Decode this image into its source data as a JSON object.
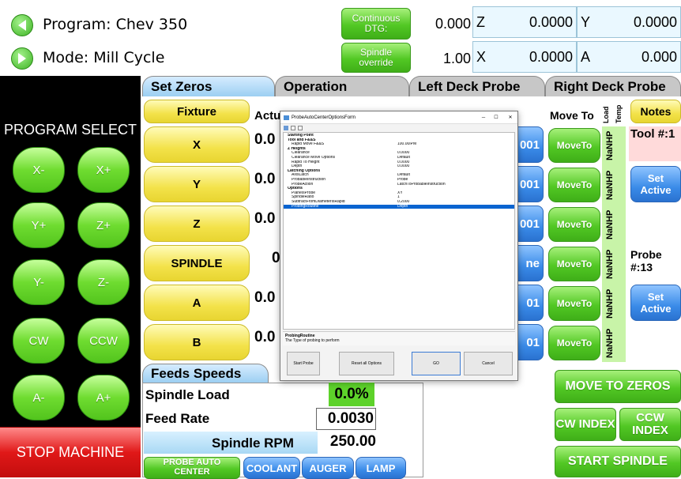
{
  "header": {
    "program_label": "Program: Chev 350",
    "mode_label": "Mode: Mill Cycle",
    "continuous_dtg": "Continuous DTG:",
    "spindle_override": "Spindle override",
    "dtg_value": "0.000",
    "override_value": "1.00",
    "axes": [
      {
        "label": "Z",
        "value": "0.0000"
      },
      {
        "label": "Y",
        "value": "0.0000"
      },
      {
        "label": "X",
        "value": "0.0000"
      },
      {
        "label": "A",
        "value": "0.000"
      }
    ]
  },
  "program_select": {
    "title": "PROGRAM SELECT",
    "buttons": [
      "X-",
      "X+",
      "Y+",
      "Z+",
      "Y-",
      "Z-",
      "CW",
      "CCW",
      "A-",
      "A+"
    ],
    "stop": "STOP MACHINE"
  },
  "tabs": [
    "Set Zeros",
    "Operation",
    "Left Deck Probe",
    "Right Deck Probe"
  ],
  "zeros": {
    "fixture": "Fixture",
    "actual_label": "Actu",
    "buttons": [
      "X",
      "Y",
      "Z",
      "SPINDLE",
      "A",
      "B"
    ],
    "values": [
      "0.0",
      "0.0",
      "0.0",
      "0",
      "0.0",
      "0.0"
    ],
    "right_partials": [
      "001",
      "001",
      "001",
      "ne",
      "01",
      "01"
    ]
  },
  "move_to": {
    "header": "Move To",
    "load": "Load",
    "temp": "Temp",
    "buttons": [
      "MoveTo",
      "MoveTo",
      "MoveTo",
      "MoveTo",
      "MoveTo",
      "MoveTo"
    ],
    "nanhp": [
      "NaNHP",
      "NaNHP",
      "NaNHP",
      "NaNHP",
      "NaNHP",
      "NaNHP"
    ]
  },
  "notes": {
    "label": "Notes",
    "tool": "Tool #:1",
    "set_active_1": "Set Active",
    "probe": "Probe #:13",
    "set_active_2": "Set Active"
  },
  "feeds": {
    "tab": "Feeds Speeds",
    "spindle_load_label": "Spindle Load",
    "spindle_load_value": "0.0%",
    "feed_rate_label": "Feed Rate",
    "feed_rate_value": "0.0030",
    "spindle_rpm_label": "Spindle RPM",
    "spindle_rpm_value": "250.00"
  },
  "bottom_buttons": {
    "probe_auto": "PROBE AUTO CENTER",
    "coolant": "COOLANT",
    "auger": "AUGER",
    "lamp": "LAMP",
    "move_to_zeros": "MOVE TO ZEROS",
    "cw_index": "CW INDEX",
    "ccw_index": "CCW INDEX",
    "start_spindle": "START SPINDLE"
  },
  "dialog": {
    "title": "ProbeAutoCenterOptionsForm",
    "rows": [
      {
        "k": "Starting Point",
        "v": "",
        "cat": true
      },
      {
        "k": "Tool and F&&S",
        "v": "",
        "cat": true
      },
      {
        "k": "Rapid Move F&&S",
        "v": "100.00IPM"
      },
      {
        "k": "Z Heights",
        "v": "",
        "cat": true
      },
      {
        "k": "Clearance",
        "v": "0.0000"
      },
      {
        "k": "Clearance Move Options",
        "v": "Default"
      },
      {
        "k": "Rapid To Height",
        "v": "0.0000"
      },
      {
        "k": "Depth",
        "v": "0.0000"
      },
      {
        "k": "Latching Options",
        "v": "",
        "cat": true
      },
      {
        "k": "AxisLatch",
        "v": "Default"
      },
      {
        "k": "ProbableInstruction",
        "v": "Probe"
      },
      {
        "k": "ProbeAction",
        "v": "LatchToProbableInstruction"
      },
      {
        "k": "Options",
        "v": "",
        "cat": true
      },
      {
        "k": "PlaneIsProbe",
        "v": "XY"
      },
      {
        "k": "SpindleRatio",
        "v": "1"
      },
      {
        "k": "SubtractFromDiameterIsRapid",
        "v": "0.2000"
      },
      {
        "k": "ProbingRoutine",
        "v": "Depth",
        "sel": true
      }
    ],
    "desc_title": "ProbingRoutine",
    "desc_text": "The Type of probing to perform",
    "btn_start": "Start Probe",
    "btn_reset": "Reset all Options",
    "btn_go": "GO",
    "btn_cancel": "Cancel"
  }
}
